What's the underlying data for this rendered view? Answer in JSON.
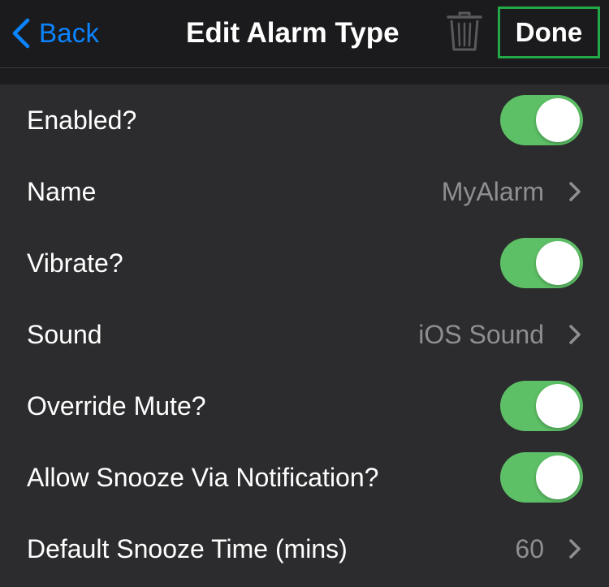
{
  "navbar": {
    "back_label": "Back",
    "title": "Edit Alarm Type",
    "done_label": "Done"
  },
  "colors": {
    "accent": "#0a84ff",
    "toggle_on": "#5dc066",
    "done_highlight": "#22a846"
  },
  "rows": [
    {
      "label": "Enabled?",
      "type": "toggle",
      "on": true
    },
    {
      "label": "Name",
      "type": "disclosure",
      "value": "MyAlarm"
    },
    {
      "label": "Vibrate?",
      "type": "toggle",
      "on": true
    },
    {
      "label": "Sound",
      "type": "disclosure",
      "value": "iOS Sound"
    },
    {
      "label": "Override Mute?",
      "type": "toggle",
      "on": true
    },
    {
      "label": "Allow Snooze Via Notification?",
      "type": "toggle",
      "on": true
    },
    {
      "label": "Default Snooze Time (mins)",
      "type": "disclosure",
      "value": "60"
    }
  ]
}
